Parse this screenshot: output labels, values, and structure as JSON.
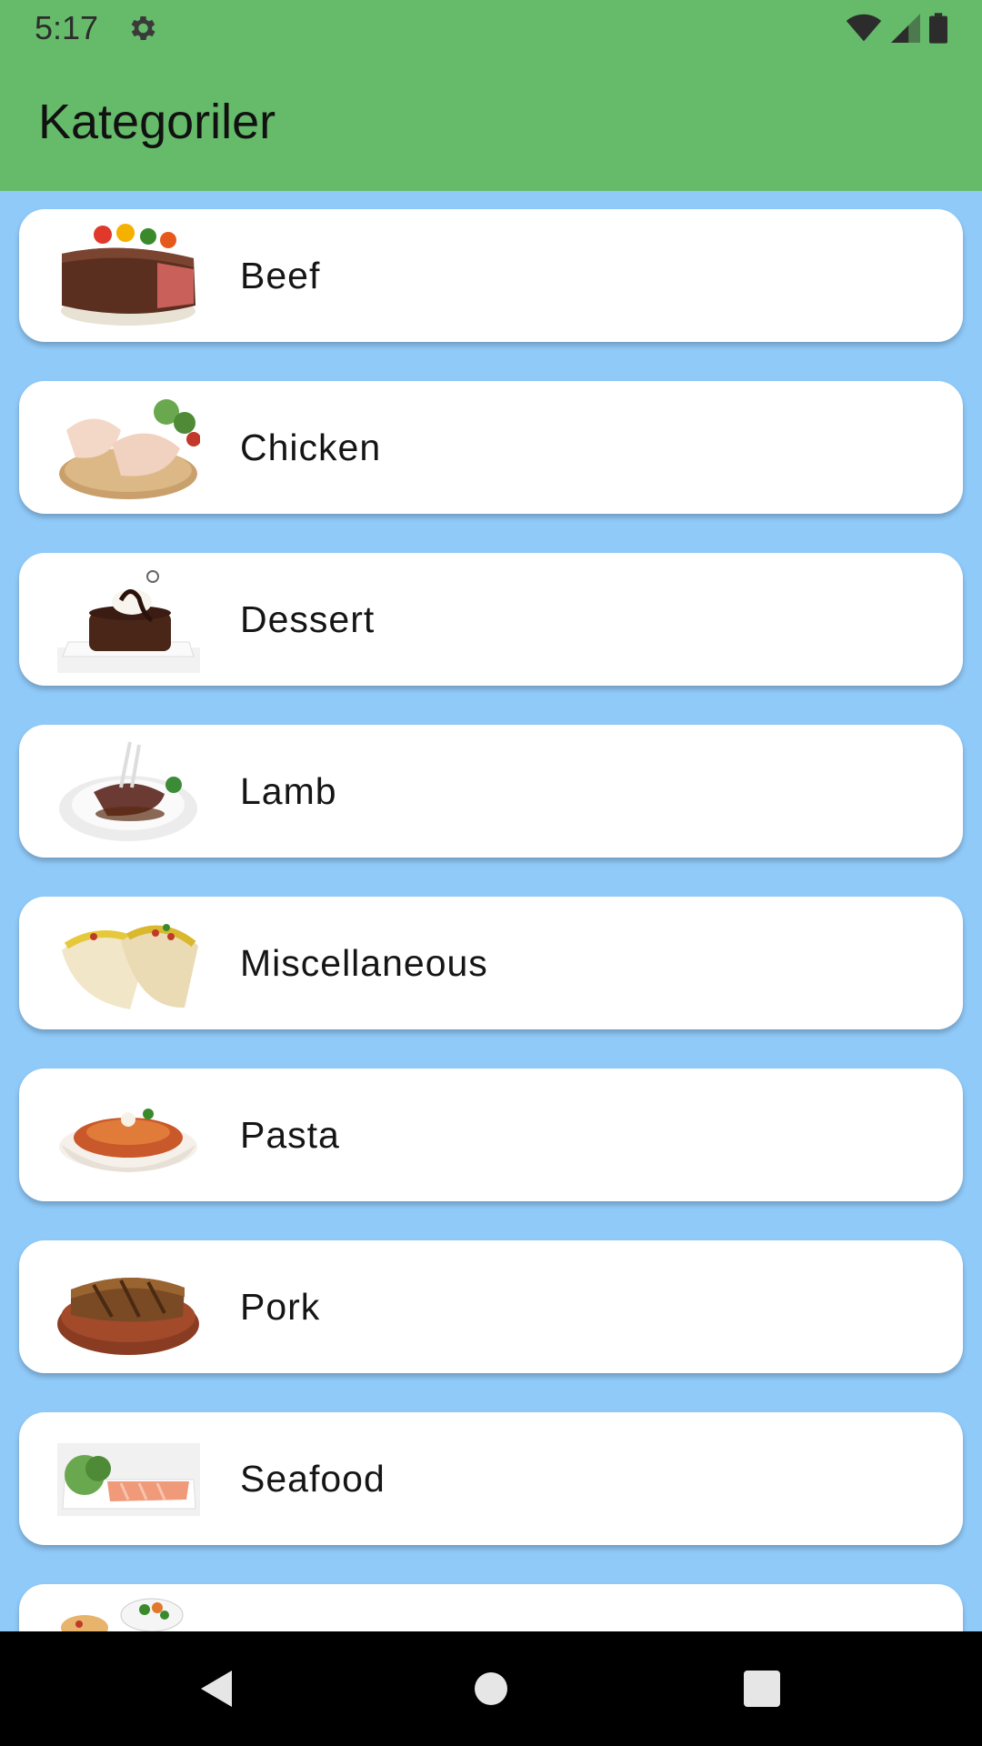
{
  "status_bar": {
    "time": "5:17",
    "icons": [
      "gear-icon",
      "wifi-icon",
      "signal-icon",
      "battery-icon"
    ]
  },
  "app_bar": {
    "title": "Kategoriler",
    "color": "#66BB6A"
  },
  "background_color": "#90CAF9",
  "categories": [
    {
      "label": "Beef",
      "thumbnail": "beef-steak"
    },
    {
      "label": "Chicken",
      "thumbnail": "raw-chicken-legs"
    },
    {
      "label": "Dessert",
      "thumbnail": "chocolate-lava-cake"
    },
    {
      "label": "Lamb",
      "thumbnail": "lamb-chops"
    },
    {
      "label": "Miscellaneous",
      "thumbnail": "tacos"
    },
    {
      "label": "Pasta",
      "thumbnail": "penne-pasta"
    },
    {
      "label": "Pork",
      "thumbnail": "pork-chop"
    },
    {
      "label": "Seafood",
      "thumbnail": "salmon-plate"
    },
    {
      "label": "",
      "thumbnail": "side-dishes"
    }
  ],
  "nav_bar": {
    "buttons": [
      "back-icon",
      "home-icon",
      "recents-icon"
    ]
  }
}
